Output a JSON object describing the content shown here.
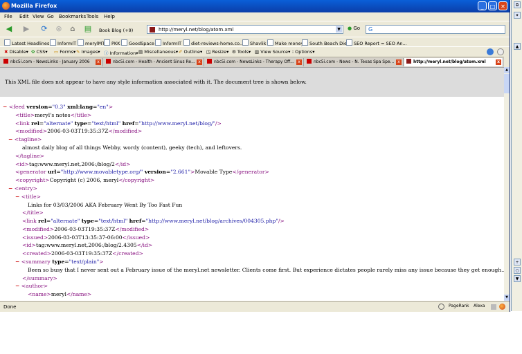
{
  "window": {
    "title": "Mozilla Firefox"
  },
  "menu": [
    "File",
    "Edit",
    "View",
    "Go",
    "Bookmarks",
    "Tools",
    "Help"
  ],
  "nav": {
    "bookblog_label": "Book Blog (+9)",
    "url": "http://meryl.net/blog/atom.xml",
    "go_label": "Go"
  },
  "bookmarks": [
    "Latest Headlines",
    "InformIT",
    "merylMT",
    "PKK",
    "GoodSpace",
    "InformIT",
    "diet-reviews-home.co...",
    "Shavlik",
    "Make money",
    "South Beach Diet",
    "SEO Report = SEO An..."
  ],
  "webdev": [
    "Disable",
    "CSS",
    "Forms",
    "Images",
    "Information",
    "Miscellaneous",
    "Outline",
    "Resize",
    "Tools",
    "View Source",
    "Options"
  ],
  "tabs": [
    {
      "label": "nbc5i.com - NewsLinks - January 2006"
    },
    {
      "label": "nbc5i.com - Health - Ancient Sinus Re..."
    },
    {
      "label": "nbc5i.com - NewsLinks - Therapy Off..."
    },
    {
      "label": "nbc5i.com - News - N. Texas Spa Spe..."
    },
    {
      "label": "http://meryl.net/blog/atom.xml"
    }
  ],
  "infobar": {
    "message": "This XML file does not appear to have any style information associated with it. The document tree is shown below."
  },
  "xml": {
    "feed_open": "feed",
    "feed_version_attr": "version",
    "feed_version": "0.3",
    "feed_lang_attr": "xml:lang",
    "feed_lang": "en",
    "title": "meryl's notes",
    "link_rel": "alternate",
    "link_type": "text/html",
    "link_href": "http://www.meryl.net/blog/",
    "modified": "2006-03-03T19:35:37Z",
    "tagline": "almost daily blog of all things Webby, wordy (content), geeky (tech), and leftovers.",
    "id": "tag:www.meryl.net,2006:/blog/2",
    "generator_url": "http://www.movabletype.org/",
    "generator_version": "2.661",
    "generator_text": "Movable Type",
    "copyright": "Copyright (c) 2006, meryl",
    "entry_title": "Links for 03/03/2006 AKA February Went By Too Fast Fun",
    "entry_link_href": "http://www.meryl.net/blog/archives/004305.php",
    "entry_modified": "2006-03-03T19:35:37Z",
    "entry_issued": "2006-03-03T13:35:37-06:00",
    "entry_id": "tag:www.meryl.net,2006:/blog/2.4305",
    "entry_created": "2006-03-03T19:35:37Z",
    "summary_type": "text/plain",
    "summary": "Been so busy that I never sent out a February issue of the meryl.net newsletter. Clients come first. But experience dictates people rarely miss any issue because they get enough...",
    "author_name": "meryl"
  },
  "status": {
    "text": "Done",
    "pagerank": "PageRank",
    "alexa": "Alexa"
  }
}
